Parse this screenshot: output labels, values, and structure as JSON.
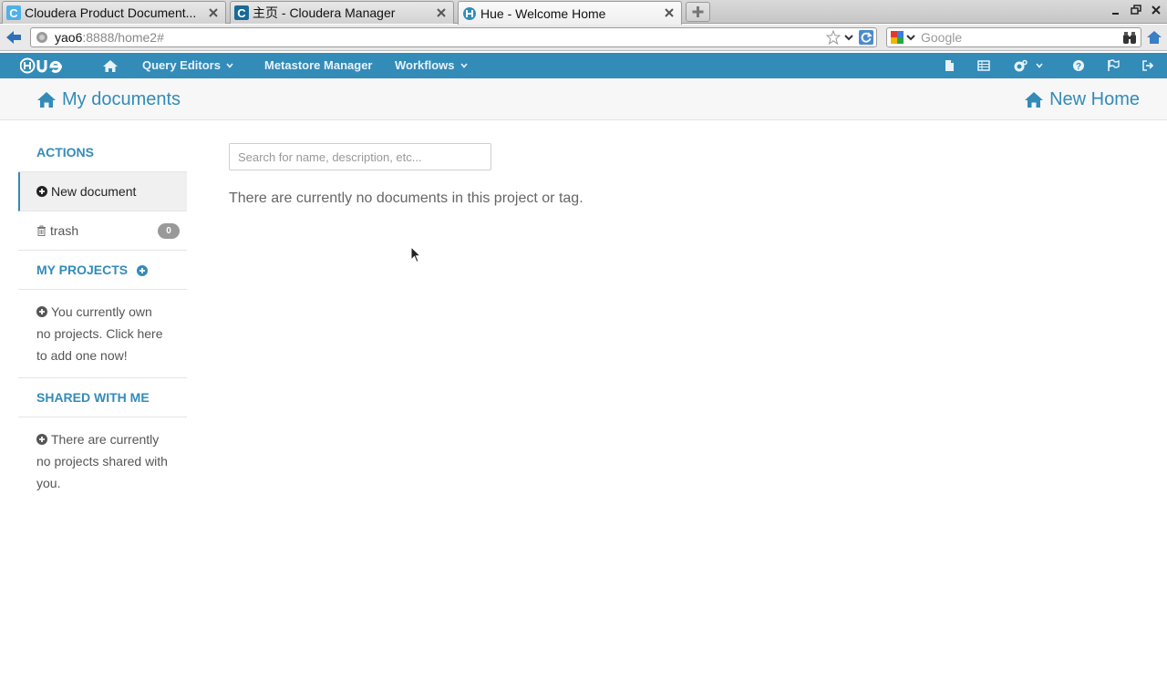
{
  "browser": {
    "tabs": [
      {
        "title": "Cloudera Product Document...",
        "favicon": "cloudera-icon"
      },
      {
        "title": "主页 - Cloudera Manager",
        "favicon": "cloudera-icon"
      },
      {
        "title": "Hue - Welcome Home",
        "favicon": "hue-icon"
      }
    ],
    "url_host": "yao6",
    "url_rest": ":8888/home2#",
    "search_placeholder": "Google"
  },
  "huenav": {
    "logo": "HUE",
    "items": [
      {
        "label": "Query Editors",
        "has_dropdown": true
      },
      {
        "label": "Metastore Manager",
        "has_dropdown": false
      },
      {
        "label": "Workflows",
        "has_dropdown": true
      }
    ],
    "right_icons": [
      "file-icon",
      "table-icon",
      "cogs-icon",
      "help-icon",
      "flag-icon",
      "logout-icon"
    ]
  },
  "header": {
    "title": "My documents",
    "new_home_label": "New Home"
  },
  "sidebar": {
    "actions_title": "ACTIONS",
    "new_document_label": "New document",
    "trash_label": "trash",
    "trash_count": "0",
    "projects_title": "MY PROJECTS",
    "projects_empty": "You currently own no projects. Click here to add one now!",
    "shared_title": "SHARED WITH ME",
    "shared_empty": "There are currently no projects shared with you."
  },
  "main": {
    "search_placeholder": "Search for name, description, etc...",
    "empty_message": "There are currently no documents in this project or tag."
  },
  "colors": {
    "accent": "#338bb8",
    "nav_bg": "#338bb8",
    "badge_bg": "#999999"
  }
}
